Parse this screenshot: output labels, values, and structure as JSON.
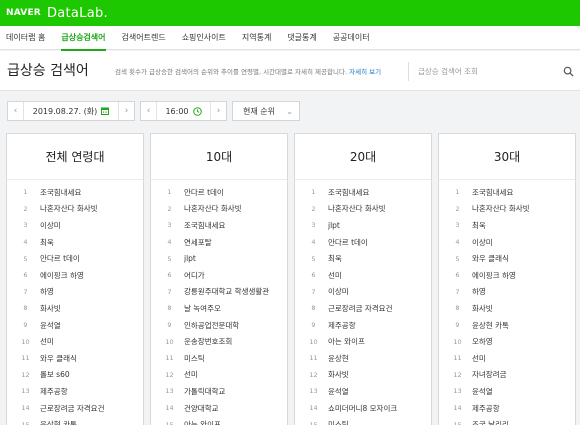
{
  "brand": {
    "naver": "NAVER",
    "datalab": "DataLab."
  },
  "nav": [
    "데이터랩 홈",
    "급상승검색어",
    "검색어트렌드",
    "쇼핑인사이트",
    "지역통계",
    "댓글통계",
    "공공데이터"
  ],
  "header": {
    "title": "급상승 검색어",
    "description": "검색 횟수가 급상승한 검색어의 순위와 추이를 연령별, 시간대별로 자세히 제공합니다.",
    "detail_link": "자세히 보기",
    "search_placeholder": "급상승 검색어 조회"
  },
  "controls": {
    "date": "2019.08.27. (화)",
    "time": "16:00",
    "sort": "현재 순위"
  },
  "panels": [
    {
      "title": "전체 연령대",
      "items": [
        "조국힘내세요",
        "나혼자산다 화사빗",
        "이상미",
        "최욱",
        "안다르 t데이",
        "에이핑크 하영",
        "하영",
        "화사빗",
        "윤석열",
        "선미",
        "와우 클래식",
        "롤보 s60",
        "제주공항",
        "근로장려금 자격요건",
        "윤상현 카톡"
      ]
    },
    {
      "title": "10대",
      "items": [
        "안다르 t데이",
        "나혼자산다 화사빗",
        "조국힘내세요",
        "연세포탈",
        "jlpt",
        "어디가",
        "강릉원주대학교 학생생활관",
        "날 녹여주오",
        "인하공업전문대학",
        "운송장번호조회",
        "미스틱",
        "선미",
        "가톨릭대학교",
        "건양대학교",
        "아는 와이프"
      ]
    },
    {
      "title": "20대",
      "items": [
        "조국힘내세요",
        "나혼자산다 화사빗",
        "jlpt",
        "안다르 t데이",
        "최욱",
        "선미",
        "이상미",
        "근로장려금 자격요건",
        "제주공항",
        "아는 와이프",
        "윤상현",
        "화사빗",
        "윤석열",
        "쇼미더머니8 모자이크",
        "미스틱"
      ]
    },
    {
      "title": "30대",
      "items": [
        "조국힘내세요",
        "나혼자산다 화사빗",
        "최욱",
        "이상미",
        "와우 클래식",
        "에이핑크 하영",
        "하영",
        "화사빗",
        "윤상현 카톡",
        "오하영",
        "선미",
        "자녀장려금",
        "윤석열",
        "제주공항",
        "조국 날리리"
      ]
    }
  ],
  "colors": {
    "brand_green": "#1ec800",
    "active_green": "#1ea81a",
    "link_blue": "#2079c5"
  }
}
